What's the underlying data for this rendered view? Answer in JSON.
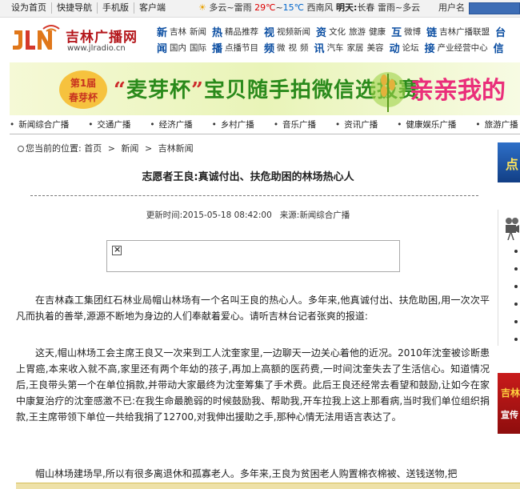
{
  "topbar": {
    "links": [
      "设为首页",
      "快捷导航",
      "手机版",
      "客户端"
    ],
    "weather": {
      "condition": "多云~雷雨",
      "high": "29℃",
      "range_sep": "~",
      "low": "15℃",
      "wind": "西南风",
      "tomorrow_label": "明天:",
      "tomorrow_city": "长春",
      "tomorrow_condition": "雷雨~多云"
    },
    "user_label": "用户名"
  },
  "site": {
    "name": "吉林广播网",
    "url": "www.jlradio.cn"
  },
  "nav": {
    "row1": [
      {
        "head": "新",
        "items": [
          "吉林",
          "新闻"
        ]
      },
      {
        "head": "热",
        "items": [
          "精品推荐"
        ]
      },
      {
        "head": "视",
        "items": [
          "视频新闻"
        ]
      },
      {
        "head": "资",
        "items": [
          "文化",
          "旅游",
          "健康"
        ]
      },
      {
        "head": "互",
        "items": [
          "微博"
        ]
      },
      {
        "head": "链",
        "items": [
          "吉林广播联盟"
        ]
      },
      {
        "head": "台",
        "items": []
      }
    ],
    "row2": [
      {
        "head": "闻",
        "items": [
          "国内",
          "国际"
        ]
      },
      {
        "head": "播",
        "items": [
          "点播节目"
        ]
      },
      {
        "head": "频",
        "items": [
          "微",
          "视",
          "频"
        ]
      },
      {
        "head": "讯",
        "items": [
          "汽车",
          "家居",
          "美容"
        ]
      },
      {
        "head": "动",
        "items": [
          "论坛"
        ]
      },
      {
        "head": "接",
        "items": [
          "产业经营中心"
        ]
      },
      {
        "head": "信",
        "items": []
      }
    ]
  },
  "banner": {
    "badge_line1": "第1届",
    "badge_line2": "春芽杯",
    "quote_open": "“",
    "title_main": "麦芽杯",
    "quote_close": "”",
    "title_rest": "宝贝随手拍微信选拔赛",
    "slogan": "亲亲我的"
  },
  "channels": [
    "新闻综合广播",
    "交通广播",
    "经济广播",
    "乡村广播",
    "音乐广播",
    "资讯广播",
    "健康娱乐广播",
    "旅游广播"
  ],
  "breadcrumb": {
    "prefix": "您当前的位置:",
    "items": [
      "首页",
      "新闻",
      "吉林新闻"
    ],
    "sep": ">"
  },
  "article": {
    "title": "志愿者王良:真诚付出、扶危助困的林场热心人",
    "updated_label": "更新时间:",
    "updated_value": "2015-05-18 08:42:00",
    "source_label": "来源:",
    "source_value": "新闻综合广播",
    "paragraphs": [
      "在吉林森工集团红石林业局帽山林场有一个名叫王良的热心人。多年来,他真诚付出、扶危助困,用一次次平凡而执着的善举,源源不断地为身边的人们奉献着爱心。请听吉林台记者张爽的报道:",
      "这天,帽山林场工会主席王良又一次来到工人沈奎家里,一边聊天一边关心着他的近况。2010年沈奎被诊断患上胃癌,本来收入就不高,家里还有两个年幼的孩子,再加上高额的医药费,一时间沈奎失去了生活信心。知道情况后,王良带头第一个在单位捐款,并带动大家最终为沈奎筹集了手术费。此后王良还经常去看望和鼓励,让如今在家中康复治疗的沈奎感激不已:在我生命最脆弱的时候鼓励我、帮助我,开车拉我上这上那看病,当时我们单位组织捐款,王主席带领下单位一共给我捐了12700,对我伸出援助之手,那种心情无法用语言表达了。",
      "帽山林场建场早,所以有很多离退休和孤寡老人。多年来,王良为贫困老人购置棉衣棉被、送钱送物,把"
    ]
  },
  "rail": {
    "ad1_char": "点",
    "ad2_line1": "吉林",
    "ad2_line2": "宣传"
  },
  "colors": {
    "brand_red": "#b4161b",
    "nav_blue": "#0b4ea2",
    "banner_green": "#2a8a1b",
    "banner_pink": "#ea2e7a",
    "temp_high": "#dd0000",
    "temp_low": "#0066cc"
  }
}
